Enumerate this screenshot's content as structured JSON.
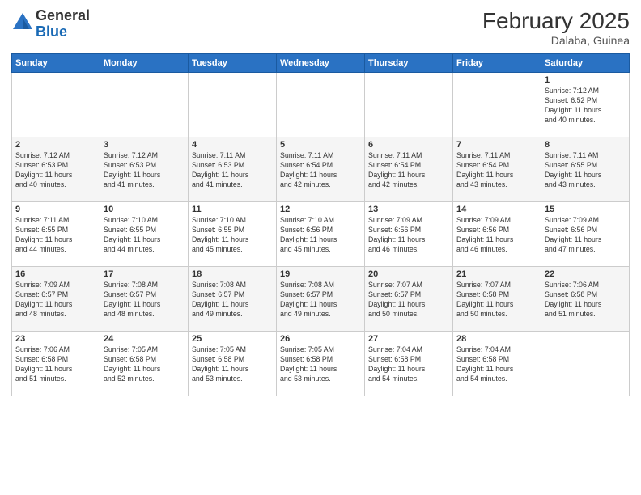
{
  "header": {
    "logo_line1": "General",
    "logo_line2": "Blue",
    "month": "February 2025",
    "location": "Dalaba, Guinea"
  },
  "weekdays": [
    "Sunday",
    "Monday",
    "Tuesday",
    "Wednesday",
    "Thursday",
    "Friday",
    "Saturday"
  ],
  "weeks": [
    [
      {
        "day": "",
        "info": ""
      },
      {
        "day": "",
        "info": ""
      },
      {
        "day": "",
        "info": ""
      },
      {
        "day": "",
        "info": ""
      },
      {
        "day": "",
        "info": ""
      },
      {
        "day": "",
        "info": ""
      },
      {
        "day": "1",
        "info": "Sunrise: 7:12 AM\nSunset: 6:52 PM\nDaylight: 11 hours\nand 40 minutes."
      }
    ],
    [
      {
        "day": "2",
        "info": "Sunrise: 7:12 AM\nSunset: 6:53 PM\nDaylight: 11 hours\nand 40 minutes."
      },
      {
        "day": "3",
        "info": "Sunrise: 7:12 AM\nSunset: 6:53 PM\nDaylight: 11 hours\nand 41 minutes."
      },
      {
        "day": "4",
        "info": "Sunrise: 7:11 AM\nSunset: 6:53 PM\nDaylight: 11 hours\nand 41 minutes."
      },
      {
        "day": "5",
        "info": "Sunrise: 7:11 AM\nSunset: 6:54 PM\nDaylight: 11 hours\nand 42 minutes."
      },
      {
        "day": "6",
        "info": "Sunrise: 7:11 AM\nSunset: 6:54 PM\nDaylight: 11 hours\nand 42 minutes."
      },
      {
        "day": "7",
        "info": "Sunrise: 7:11 AM\nSunset: 6:54 PM\nDaylight: 11 hours\nand 43 minutes."
      },
      {
        "day": "8",
        "info": "Sunrise: 7:11 AM\nSunset: 6:55 PM\nDaylight: 11 hours\nand 43 minutes."
      }
    ],
    [
      {
        "day": "9",
        "info": "Sunrise: 7:11 AM\nSunset: 6:55 PM\nDaylight: 11 hours\nand 44 minutes."
      },
      {
        "day": "10",
        "info": "Sunrise: 7:10 AM\nSunset: 6:55 PM\nDaylight: 11 hours\nand 44 minutes."
      },
      {
        "day": "11",
        "info": "Sunrise: 7:10 AM\nSunset: 6:55 PM\nDaylight: 11 hours\nand 45 minutes."
      },
      {
        "day": "12",
        "info": "Sunrise: 7:10 AM\nSunset: 6:56 PM\nDaylight: 11 hours\nand 45 minutes."
      },
      {
        "day": "13",
        "info": "Sunrise: 7:09 AM\nSunset: 6:56 PM\nDaylight: 11 hours\nand 46 minutes."
      },
      {
        "day": "14",
        "info": "Sunrise: 7:09 AM\nSunset: 6:56 PM\nDaylight: 11 hours\nand 46 minutes."
      },
      {
        "day": "15",
        "info": "Sunrise: 7:09 AM\nSunset: 6:56 PM\nDaylight: 11 hours\nand 47 minutes."
      }
    ],
    [
      {
        "day": "16",
        "info": "Sunrise: 7:09 AM\nSunset: 6:57 PM\nDaylight: 11 hours\nand 48 minutes."
      },
      {
        "day": "17",
        "info": "Sunrise: 7:08 AM\nSunset: 6:57 PM\nDaylight: 11 hours\nand 48 minutes."
      },
      {
        "day": "18",
        "info": "Sunrise: 7:08 AM\nSunset: 6:57 PM\nDaylight: 11 hours\nand 49 minutes."
      },
      {
        "day": "19",
        "info": "Sunrise: 7:08 AM\nSunset: 6:57 PM\nDaylight: 11 hours\nand 49 minutes."
      },
      {
        "day": "20",
        "info": "Sunrise: 7:07 AM\nSunset: 6:57 PM\nDaylight: 11 hours\nand 50 minutes."
      },
      {
        "day": "21",
        "info": "Sunrise: 7:07 AM\nSunset: 6:58 PM\nDaylight: 11 hours\nand 50 minutes."
      },
      {
        "day": "22",
        "info": "Sunrise: 7:06 AM\nSunset: 6:58 PM\nDaylight: 11 hours\nand 51 minutes."
      }
    ],
    [
      {
        "day": "23",
        "info": "Sunrise: 7:06 AM\nSunset: 6:58 PM\nDaylight: 11 hours\nand 51 minutes."
      },
      {
        "day": "24",
        "info": "Sunrise: 7:05 AM\nSunset: 6:58 PM\nDaylight: 11 hours\nand 52 minutes."
      },
      {
        "day": "25",
        "info": "Sunrise: 7:05 AM\nSunset: 6:58 PM\nDaylight: 11 hours\nand 53 minutes."
      },
      {
        "day": "26",
        "info": "Sunrise: 7:05 AM\nSunset: 6:58 PM\nDaylight: 11 hours\nand 53 minutes."
      },
      {
        "day": "27",
        "info": "Sunrise: 7:04 AM\nSunset: 6:58 PM\nDaylight: 11 hours\nand 54 minutes."
      },
      {
        "day": "28",
        "info": "Sunrise: 7:04 AM\nSunset: 6:58 PM\nDaylight: 11 hours\nand 54 minutes."
      },
      {
        "day": "",
        "info": ""
      }
    ]
  ]
}
